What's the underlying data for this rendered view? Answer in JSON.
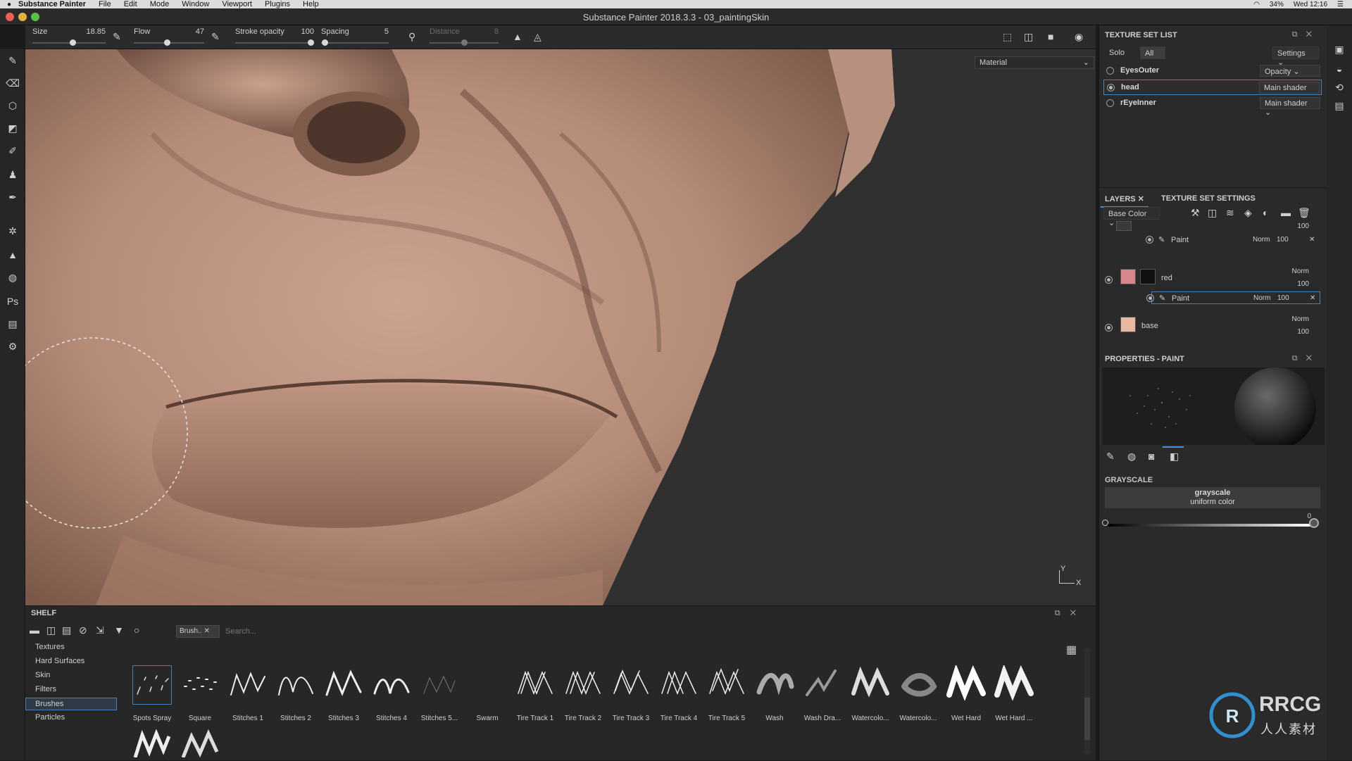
{
  "menubar": {
    "app": "Substance Painter",
    "items": [
      "File",
      "Edit",
      "Mode",
      "Window",
      "Viewport",
      "Plugins",
      "Help"
    ],
    "battery": "34%",
    "clock": "Wed 12:16"
  },
  "window": {
    "title": "Substance Painter 2018.3.3 - 03_paintingSkin"
  },
  "toolbar": {
    "size": {
      "label": "Size",
      "value": "18.85",
      "fraction": 0.55
    },
    "flow": {
      "label": "Flow",
      "value": "47",
      "fraction": 0.47
    },
    "stroke_opacity": {
      "label": "Stroke opacity",
      "value": "100",
      "fraction": 1.0
    },
    "spacing": {
      "label": "Spacing",
      "value": "5",
      "fraction": 0.05
    },
    "distance": {
      "label": "Distance",
      "value": "8",
      "fraction": 0.5
    }
  },
  "viewport": {
    "mode": "Material",
    "axis_x": "X",
    "axis_y": "Y"
  },
  "texture_set_list": {
    "title": "TEXTURE SET LIST",
    "solo": "Solo",
    "all": "All",
    "settings": "Settings",
    "rows": [
      {
        "name": "EyesOuter",
        "shader": "Opacity"
      },
      {
        "name": "head",
        "shader": "Main shader"
      },
      {
        "name": "rEyeInner",
        "shader": "Main shader"
      }
    ]
  },
  "layers_panel": {
    "tab_layers": "LAYERS",
    "tab_tss": "TEXTURE SET SETTINGS",
    "channel": "Base Color",
    "top_opacity": "100",
    "paint1": {
      "name": "Paint",
      "blend": "Norm",
      "opacity": "100"
    },
    "red": {
      "name": "red",
      "blend": "Norm",
      "opacity": "100"
    },
    "paint2": {
      "name": "Paint",
      "blend": "Norm",
      "opacity": "100"
    },
    "base": {
      "name": "base",
      "blend": "Norm",
      "opacity": "100"
    }
  },
  "properties": {
    "title": "PROPERTIES - PAINT",
    "section": "GRAYSCALE",
    "mode_line1": "grayscale",
    "mode_line2": "uniform color",
    "value": "0"
  },
  "shelf": {
    "title": "SHELF",
    "filter_chip": "Brush..",
    "search_placeholder": "Search...",
    "categories": [
      "Textures",
      "Hard Surfaces",
      "Skin",
      "Filters",
      "Brushes",
      "Particles"
    ],
    "brushes": [
      "Spots Spray",
      "Square",
      "Stitches 1",
      "Stitches 2",
      "Stitches 3",
      "Stitches 4",
      "Stitches 5...",
      "Swarm",
      "Tire Track 1",
      "Tire Track 2",
      "Tire Track 3",
      "Tire Track 4",
      "Tire Track 5",
      "Wash",
      "Wash Dra...",
      "Watercolo...",
      "Watercolo...",
      "Wet Hard",
      "Wet Hard ..."
    ]
  },
  "watermark": {
    "line1": "RRCG",
    "line2": "人人素材"
  },
  "colors": {
    "accent": "#4a8fd6",
    "skin": "#c49a86",
    "red_layer": "#d9868a",
    "base_layer": "#e8b9a0"
  }
}
